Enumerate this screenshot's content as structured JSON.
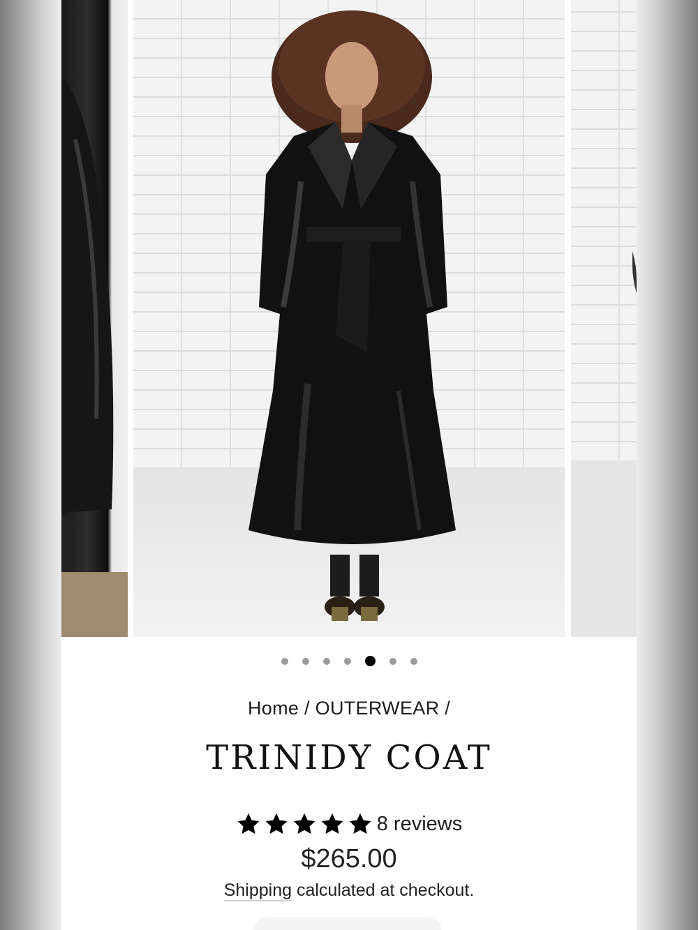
{
  "gallery": {
    "dots_total": 7,
    "active_dot": 5,
    "zoom_icon": "magnifier-icon"
  },
  "breadcrumb": {
    "home": "Home",
    "separator": "/",
    "category": "OUTERWEAR"
  },
  "product": {
    "title": "TRINIDY COAT",
    "rating": 5,
    "rating_max": 5,
    "reviews_label": "8 reviews",
    "price": "$265.00",
    "shipping_link": "Shipping",
    "shipping_rest": "calculated at checkout."
  },
  "colors": {
    "accent": "#000000",
    "dot_inactive": "#9b9b9b"
  }
}
